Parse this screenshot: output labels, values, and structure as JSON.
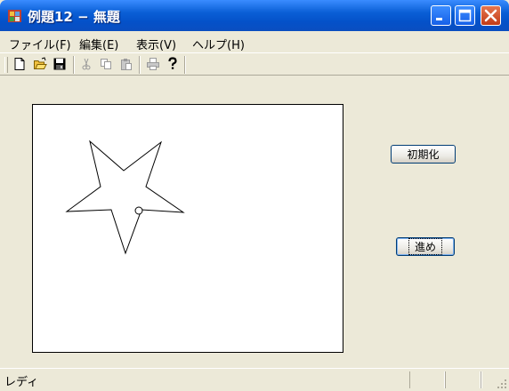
{
  "window": {
    "title": "例題12 − 無題",
    "app_icon": "app-icon"
  },
  "menu": [
    {
      "label": "ファイル(F)"
    },
    {
      "label": "編集(E)"
    },
    {
      "label": "表示(V)"
    },
    {
      "label": "ヘルプ(H)"
    }
  ],
  "toolbar": {
    "icons": [
      "new-file-icon",
      "open-folder-icon",
      "save-icon",
      "cut-icon",
      "copy-icon",
      "paste-icon",
      "print-icon",
      "help-icon"
    ]
  },
  "buttons": {
    "reset_label": "初期化",
    "advance_label": "進め"
  },
  "status": {
    "text": "レディ"
  }
}
